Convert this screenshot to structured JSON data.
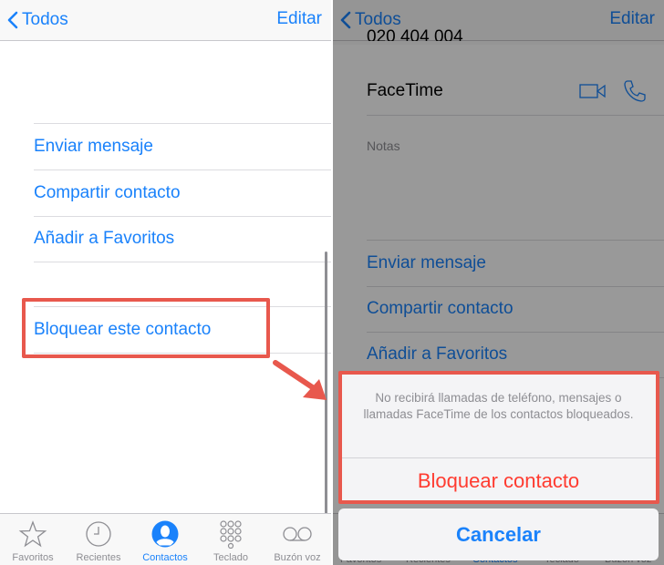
{
  "left": {
    "nav": {
      "back_label": "Todos",
      "edit_label": "Editar"
    },
    "actions": [
      "Enviar mensaje",
      "Compartir contacto",
      "Añadir a Favoritos"
    ],
    "block_label": "Bloquear este contacto",
    "tabs": [
      {
        "label": "Favoritos",
        "icon": "star-icon"
      },
      {
        "label": "Recientes",
        "icon": "clock-icon"
      },
      {
        "label": "Contactos",
        "icon": "person-icon"
      },
      {
        "label": "Teclado",
        "icon": "keypad-icon"
      },
      {
        "label": "Buzón voz",
        "icon": "voicemail-icon"
      }
    ]
  },
  "right": {
    "nav": {
      "back_label": "Todos",
      "edit_label": "Editar"
    },
    "partial_phone": "020 404 004",
    "facetime_label": "FaceTime",
    "notes_label": "Notas",
    "actions": [
      "Enviar mensaje",
      "Compartir contacto",
      "Añadir a Favoritos"
    ],
    "sheet": {
      "message": "No recibirá llamadas de teléfono, mensajes o llamadas FaceTime de los contactos bloqueados.",
      "block_button": "Bloquear contacto",
      "cancel_button": "Cancelar"
    },
    "tabs": [
      "Favoritos",
      "Recientes",
      "Contactos",
      "Teclado",
      "Buzón voz"
    ]
  },
  "colors": {
    "accent": "#1a82fb",
    "destructive": "#ff3b30",
    "highlight": "#e8584d"
  }
}
